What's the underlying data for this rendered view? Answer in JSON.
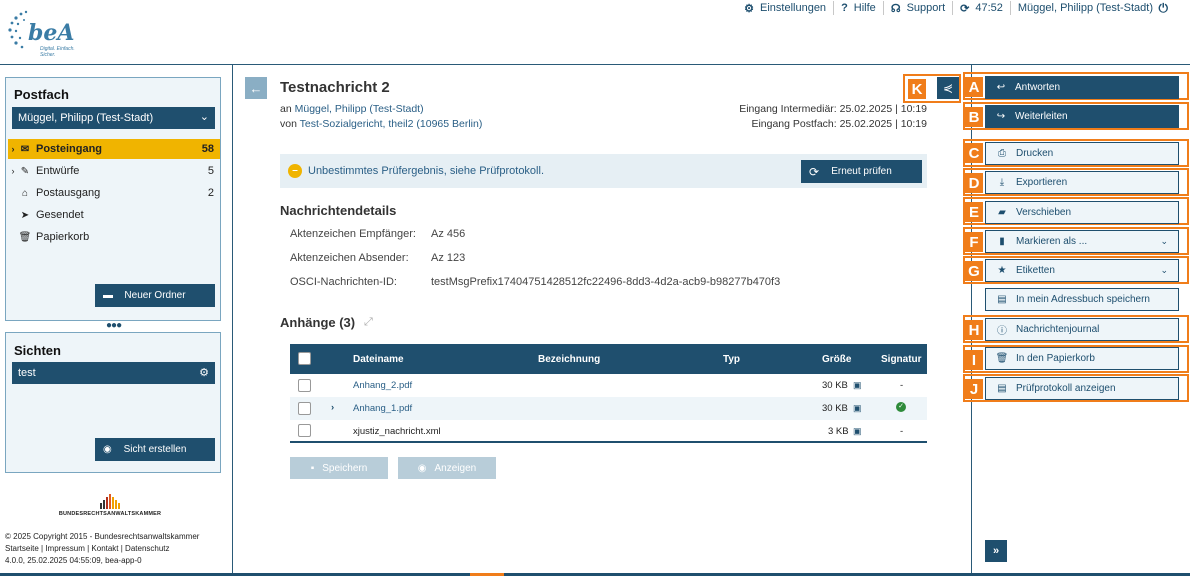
{
  "brand": {
    "logo_text": "beA",
    "logo_sub": "Digital. Einfach. Sicher.",
    "bar_colors": [
      "#333333",
      "#333333",
      "#b0301e",
      "#e05a20",
      "#f0a000"
    ],
    "brak_name": "BUNDESRECHTSANWALTSKAMMER"
  },
  "topnav": {
    "settings": "Einstellungen",
    "help": "Hilfe",
    "support": "Support",
    "timer": "47:52",
    "user": "Müggel, Philipp (Test-Stadt)"
  },
  "postfach": {
    "title": "Postfach",
    "selected": "Müggel, Philipp (Test-Stadt)",
    "folders": [
      {
        "label": "Posteingang",
        "count": "58"
      },
      {
        "label": "Entwürfe",
        "count": "5"
      },
      {
        "label": "Postausgang",
        "count": "2"
      },
      {
        "label": "Gesendet",
        "count": ""
      },
      {
        "label": "Papierkorb",
        "count": ""
      }
    ],
    "new_folder": "Neuer Ordner"
  },
  "sichten": {
    "title": "Sichten",
    "item": "test",
    "create": "Sicht erstellen"
  },
  "footer": {
    "line1": "© 2025 Copyright 2015 - Bundesrechtsanwaltskammer",
    "line2": "Startseite | Impressum | Kontakt | Datenschutz",
    "line3": "4.0.0, 25.02.2025 04:55:09, bea-app-0"
  },
  "message": {
    "title": "Testnachricht 2",
    "to_prefix": "an",
    "to": "Müggel, Philipp (Test-Stadt)",
    "from_prefix": "von",
    "from": "Test-Sozialgericht, theil2 (10965 Berlin)",
    "received_intermediary": "Eingang Intermediär: 25.02.2025 | 10:19",
    "received_postfach": "Eingang Postfach: 25.02.2025 | 10:19"
  },
  "warning": {
    "text": "Unbestimmtes Prüfergebnis, siehe Prüfprotokoll.",
    "recheck": "Erneut prüfen"
  },
  "details": {
    "title": "Nachrichtendetails",
    "rows": [
      {
        "label": "Aktenzeichen Empfänger:",
        "value": "Az 456"
      },
      {
        "label": "Aktenzeichen Absender:",
        "value": "Az 123"
      },
      {
        "label": "OSCI-Nachrichten-ID:",
        "value": "testMsgPrefix17404751428512fc22496-8dd3-4d2a-acb9-b98277b470f3"
      }
    ]
  },
  "attachments": {
    "title": "Anhänge (3)",
    "headers": {
      "name": "Dateiname",
      "desc": "Bezeichnung",
      "type": "Typ",
      "size": "Größe",
      "signature": "Signatur"
    },
    "rows": [
      {
        "name": "Anhang_2.pdf",
        "size": "30 KB",
        "signature": "-"
      },
      {
        "name": "Anhang_1.pdf",
        "size": "30 KB",
        "signature": "✓"
      },
      {
        "name": "xjustiz_nachricht.xml",
        "size": "3 KB",
        "signature": "-"
      }
    ],
    "save": "Speichern",
    "view": "Anzeigen"
  },
  "actions": [
    {
      "key": "A",
      "label": "Antworten"
    },
    {
      "key": "B",
      "label": "Weiterleiten"
    },
    {
      "key": "C",
      "label": "Drucken"
    },
    {
      "key": "D",
      "label": "Exportieren"
    },
    {
      "key": "E",
      "label": "Verschieben"
    },
    {
      "key": "F",
      "label": "Markieren als ..."
    },
    {
      "key": "G",
      "label": "Etiketten"
    },
    {
      "key": "",
      "label": "In mein Adressbuch speichern"
    },
    {
      "key": "H",
      "label": "Nachrichtenjournal"
    },
    {
      "key": "I",
      "label": "In den Papierkorb"
    },
    {
      "key": "J",
      "label": "Prüfprotokoll anzeigen"
    }
  ],
  "share_key": "K",
  "colors": {
    "primary": "#1f4f6e",
    "accent": "#f0b400",
    "highlight": "#f07d1a",
    "success": "#2e8b3a"
  }
}
